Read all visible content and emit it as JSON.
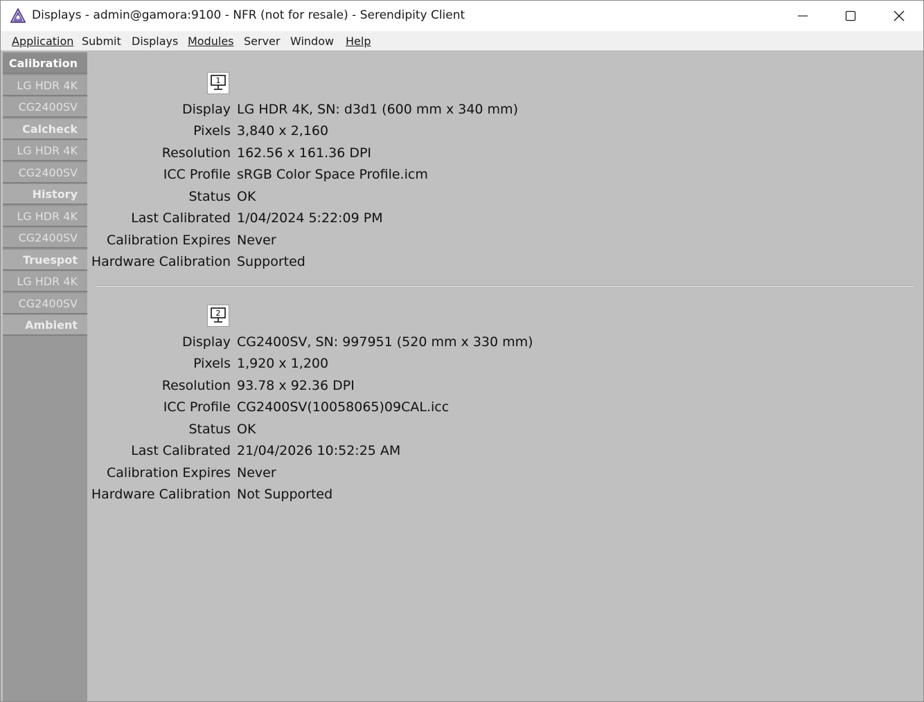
{
  "window": {
    "title": "Displays - admin@gamora:9100 - NFR (not for resale) - Serendipity Client"
  },
  "menu": [
    {
      "label": "Application",
      "underline": true
    },
    {
      "label": "Submit",
      "underline": false
    },
    {
      "label": "Displays",
      "underline": false
    },
    {
      "label": "Modules",
      "underline": true
    },
    {
      "label": "Server",
      "underline": false
    },
    {
      "label": "Window",
      "underline": false
    },
    {
      "label": "Help",
      "underline": true
    }
  ],
  "sidebar": {
    "items": [
      {
        "label": "Calibration",
        "type": "header",
        "active": true
      },
      {
        "label": "LG HDR 4K",
        "type": "sub"
      },
      {
        "label": "CG2400SV",
        "type": "sub"
      },
      {
        "label": "Calcheck",
        "type": "header"
      },
      {
        "label": "LG HDR 4K",
        "type": "sub"
      },
      {
        "label": "CG2400SV",
        "type": "sub"
      },
      {
        "label": "History",
        "type": "header"
      },
      {
        "label": "LG HDR 4K",
        "type": "sub"
      },
      {
        "label": "CG2400SV",
        "type": "sub"
      },
      {
        "label": "Truespot",
        "type": "header"
      },
      {
        "label": "LG HDR 4K",
        "type": "sub"
      },
      {
        "label": "CG2400SV",
        "type": "sub"
      },
      {
        "label": "Ambient",
        "type": "header"
      }
    ]
  },
  "displays": [
    {
      "index": "1",
      "rows": [
        {
          "label": "Display",
          "value": "LG HDR 4K, SN: d3d1 (600 mm x 340 mm)"
        },
        {
          "label": "Pixels",
          "value": "3,840 x 2,160"
        },
        {
          "label": "Resolution",
          "value": "162.56 x 161.36 DPI"
        },
        {
          "label": "ICC Profile",
          "value": "sRGB Color Space Profile.icm"
        },
        {
          "label": "Status",
          "value": "OK"
        },
        {
          "label": "Last Calibrated",
          "value": "1/04/2024 5:22:09 PM"
        },
        {
          "label": "Calibration Expires",
          "value": "Never"
        },
        {
          "label": "Hardware Calibration",
          "value": "Supported"
        }
      ]
    },
    {
      "index": "2",
      "rows": [
        {
          "label": "Display",
          "value": "CG2400SV, SN: 997951 (520 mm x 330 mm)"
        },
        {
          "label": "Pixels",
          "value": "1,920 x 1,200"
        },
        {
          "label": "Resolution",
          "value": "93.78 x 92.36 DPI"
        },
        {
          "label": "ICC Profile",
          "value": "CG2400SV(10058065)09CAL.icc"
        },
        {
          "label": "Status",
          "value": "OK"
        },
        {
          "label": "Last Calibrated",
          "value": "21/04/2026 10:52:25 AM"
        },
        {
          "label": "Calibration Expires",
          "value": "Never"
        },
        {
          "label": "Hardware Calibration",
          "value": "Not Supported"
        }
      ]
    }
  ],
  "colors": {
    "content_bg": "#c0c0c0",
    "sidebar_bg": "#999999",
    "titlebar_bg": "#ffffff",
    "menubar_bg": "#f0f0f0"
  }
}
